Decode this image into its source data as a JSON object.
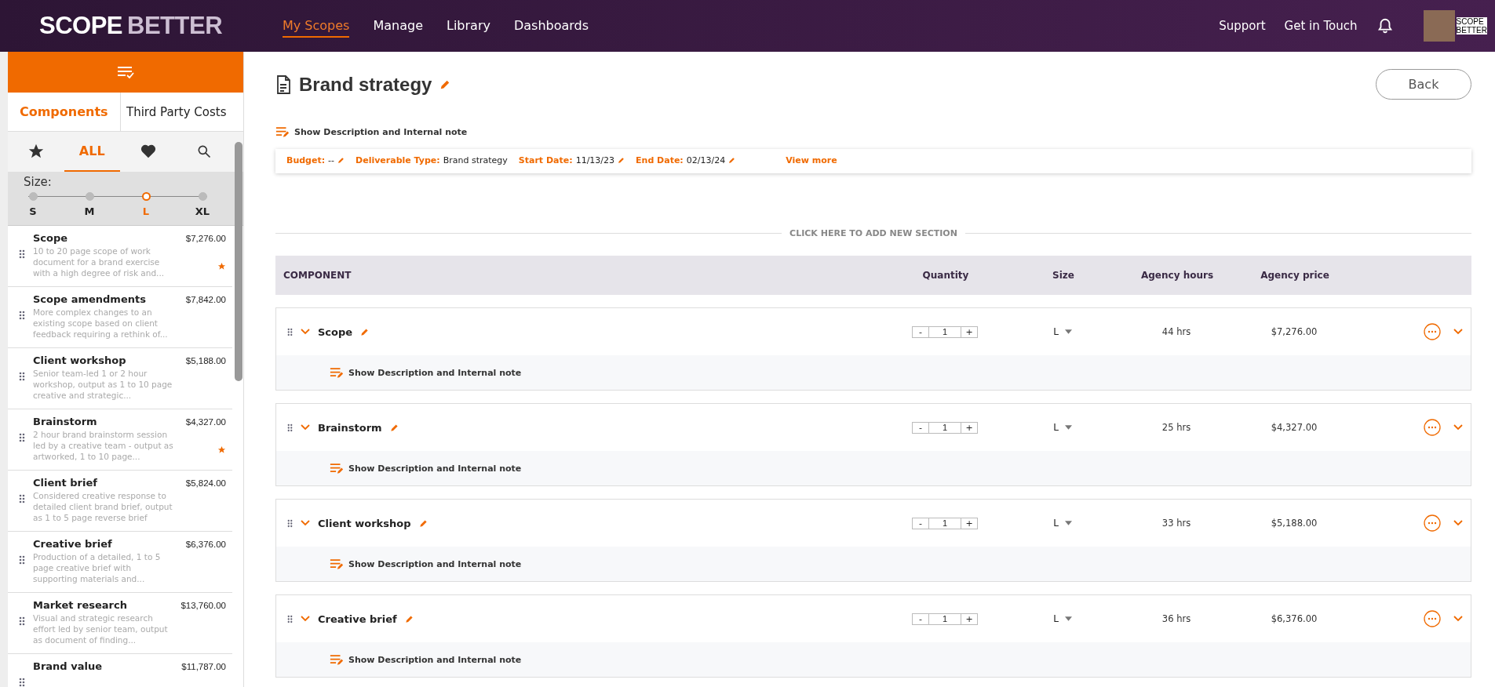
{
  "header": {
    "logo": {
      "part1": "SCOPE",
      "part2": "BETTER"
    },
    "nav": [
      {
        "label": "My Scopes",
        "selected": true
      },
      {
        "label": "Manage",
        "selected": false
      },
      {
        "label": "Library",
        "selected": false
      },
      {
        "label": "Dashboards",
        "selected": false
      }
    ],
    "links": [
      "Support",
      "Get in Touch"
    ],
    "brand_mark": [
      "SCOPE",
      "BETTER"
    ]
  },
  "sidebar": {
    "tabs": [
      {
        "label": "Components",
        "selected": true
      },
      {
        "label": "Third Party Costs",
        "selected": false
      }
    ],
    "filters": [
      {
        "kind": "star",
        "selected": false
      },
      {
        "kind": "all",
        "label": "ALL",
        "selected": true
      },
      {
        "kind": "heart",
        "selected": false
      },
      {
        "kind": "search",
        "selected": false
      }
    ],
    "size_label": "Size:",
    "sizes": [
      {
        "label": "S",
        "selected": false
      },
      {
        "label": "M",
        "selected": false
      },
      {
        "label": "L",
        "selected": true
      },
      {
        "label": "XL",
        "selected": false
      }
    ],
    "items": [
      {
        "name": "Scope",
        "price": "$7,276.00",
        "description": "10 to 20 page scope of work document for a brand exercise with a high degree of risk and...",
        "starred": true
      },
      {
        "name": "Scope amendments",
        "price": "$7,842.00",
        "description": "More complex changes to an existing scope based on client feedback requiring a rethink of...",
        "starred": false
      },
      {
        "name": "Client workshop",
        "price": "$5,188.00",
        "description": "Senior team-led 1 or 2 hour workshop, output as 1 to 10 page creative and strategic...",
        "starred": false
      },
      {
        "name": "Brainstorm",
        "price": "$4,327.00",
        "description": "2 hour brand brainstorm session led by a creative team - output as artworked, 1 to 10 page...",
        "starred": true
      },
      {
        "name": "Client brief",
        "price": "$5,824.00",
        "description": "Considered creative response to detailed client brand brief, output as 1 to 5 page reverse brief",
        "starred": false
      },
      {
        "name": "Creative brief",
        "price": "$6,376.00",
        "description": "Production of a detailed, 1 to 5 page creative brief with supporting materials and...",
        "starred": false
      },
      {
        "name": "Market research",
        "price": "$13,760.00",
        "description": "Visual and strategic research effort led by senior team, output as document of finding...",
        "starred": false
      },
      {
        "name": "Brand value",
        "price": "$11,787.00",
        "starred": false
      }
    ]
  },
  "main": {
    "title": "Brand strategy",
    "back": "Back",
    "note_toggle": "Show Description and Internal note",
    "details": [
      {
        "label": "Budget:",
        "value": "--",
        "editable": true
      },
      {
        "label": "Deliverable Type:",
        "value": "Brand strategy",
        "editable": false
      },
      {
        "label": "Start Date:",
        "value": "11/13/23",
        "editable": true
      },
      {
        "label": "End Date:",
        "value": "02/13/24",
        "editable": true
      }
    ],
    "view_more": "View more",
    "add_section": "CLICK HERE TO ADD NEW SECTION",
    "columns": [
      "COMPONENT",
      "Quantity",
      "Size",
      "Agency hours",
      "Agency price"
    ],
    "rows": [
      {
        "name": "Scope",
        "minus": "-",
        "quantity": "1",
        "plus": "+",
        "size": "L",
        "hours": "44 hrs",
        "price": "$7,276.00",
        "note": "Show Description and Internal note"
      },
      {
        "name": "Brainstorm",
        "minus": "-",
        "quantity": "1",
        "plus": "+",
        "size": "L",
        "hours": "25 hrs",
        "price": "$4,327.00",
        "note": "Show Description and Internal note"
      },
      {
        "name": "Client workshop",
        "minus": "-",
        "quantity": "1",
        "plus": "+",
        "size": "L",
        "hours": "33 hrs",
        "price": "$5,188.00",
        "note": "Show Description and Internal note"
      },
      {
        "name": "Creative brief",
        "minus": "-",
        "quantity": "1",
        "plus": "+",
        "size": "L",
        "hours": "36 hrs",
        "price": "$6,376.00",
        "note": "Show Description and Internal note"
      }
    ]
  }
}
